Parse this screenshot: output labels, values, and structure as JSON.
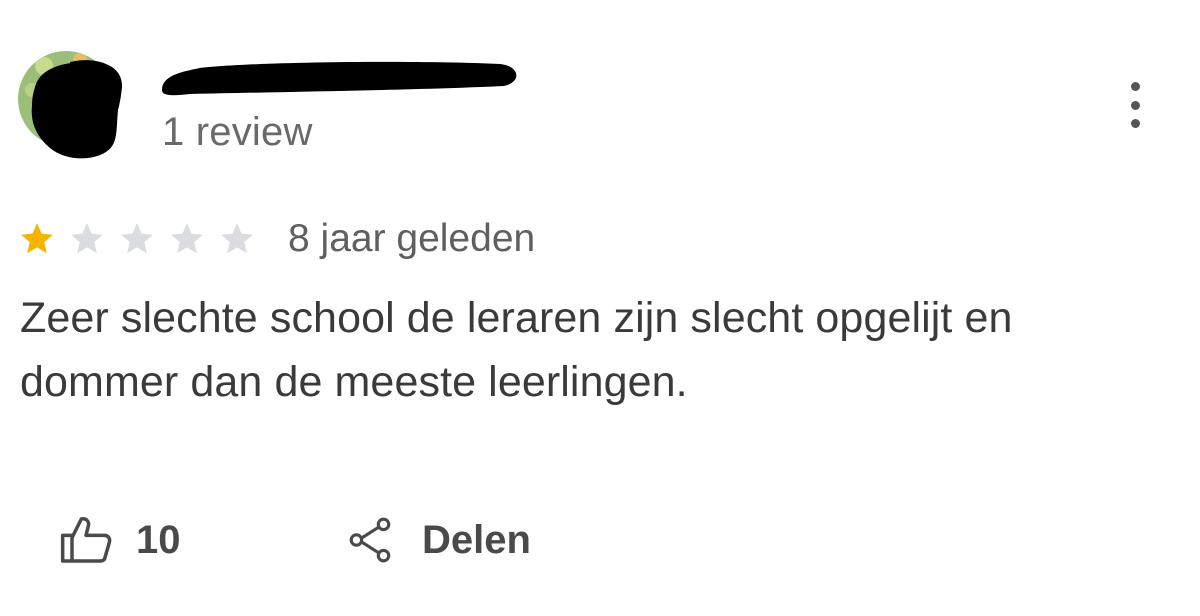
{
  "reviewer": {
    "review_count_text": "1 review"
  },
  "review": {
    "rating": 1,
    "max_rating": 5,
    "date": "8 jaar geleden",
    "text": "Zeer slechte school de leraren zijn slecht opgelijt en dommer dan de meeste leerlingen."
  },
  "actions": {
    "like_count": "10",
    "share_label": "Delen"
  },
  "colors": {
    "star_filled": "#f4b400",
    "star_empty": "#dadce0",
    "text": "#3a3a3a",
    "muted": "#6a6a6a"
  },
  "icons": {
    "more": "more-vert-icon",
    "like": "thumb-up-icon",
    "share": "share-icon"
  }
}
